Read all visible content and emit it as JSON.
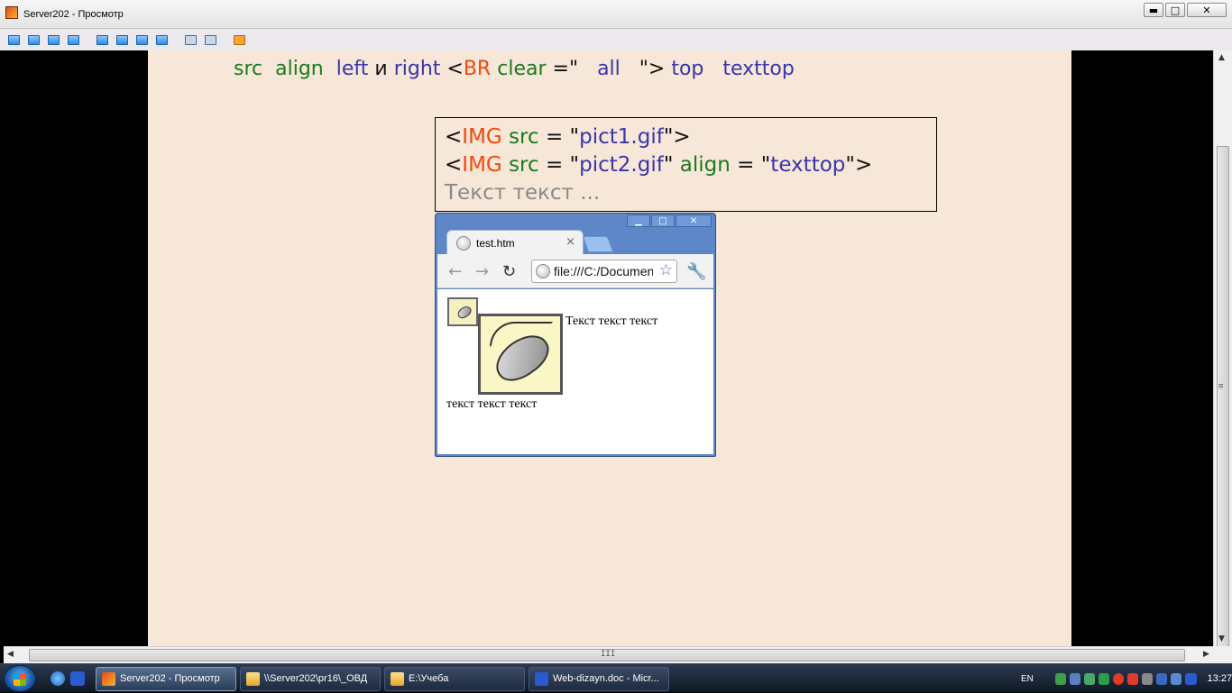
{
  "window": {
    "title": "Server202 - Просмотр",
    "buttons": {
      "minimize": "▬",
      "maximize": "□",
      "close": "✕"
    }
  },
  "toolbar": {
    "icons": [
      "monitor-icon",
      "chat-icon",
      "phone-icon",
      "message-icon",
      "window-icon",
      "fit-icon",
      "fullscreen-icon",
      "scale-icon",
      "copy-icon",
      "tools-icon",
      "close-session-icon"
    ]
  },
  "slide": {
    "topline": {
      "src": "src",
      "align": "align",
      "left": "left",
      "and": "и",
      "right": "right",
      "lt": "<",
      "br": "BR",
      "clear": "clear",
      "eq_quote": "=\"",
      "all": "all",
      "quote_gt": "\">",
      "top": "top",
      "texttop": "texttop"
    },
    "code": {
      "line1": {
        "lt": "<",
        "tag": "IMG",
        "attr": "src",
        "eq": " = ",
        "q1": "\"",
        "value": "pict1.gif",
        "q2_gt": "\">"
      },
      "line2": {
        "lt": "<",
        "tag": "IMG",
        "attr": "src",
        "eq": " = ",
        "q1": "\"",
        "value": "pict2.gif",
        "q2": "\"",
        "attr2": "align",
        "eq2": " = ",
        "q3": "\"",
        "value2": "texttop",
        "q4_gt": "\">"
      },
      "line3": "Текст текст ..."
    },
    "browser": {
      "window_buttons": {
        "minimize": "▁",
        "maximize": "□",
        "close": "✕"
      },
      "tab_title": "test.htm",
      "tab_close": "×",
      "back": "←",
      "forward": "→",
      "reload": "↻",
      "url": "file:///C:/Documents",
      "star": "☆",
      "wrench": "🔧",
      "text_right": "Текст текст текст",
      "text_below": "текст текст текст"
    }
  },
  "scrollbars": {
    "up": "▲",
    "down": "▼",
    "left": "◀",
    "right": "▶",
    "grip": "III"
  },
  "taskbar": {
    "buttons": [
      {
        "label": "Server202 - Просмотр",
        "icon": "app"
      },
      {
        "label": "\\\\Server202\\pr16\\_ОВД",
        "icon": "folder"
      },
      {
        "label": "E:\\Учеба",
        "icon": "folder"
      },
      {
        "label": "Web-dizayn.doc - Micr...",
        "icon": "word"
      }
    ],
    "language": "EN",
    "clock": "13:27",
    "colors": {
      "accent": "#2b3a52"
    }
  },
  "colors": {
    "slide_bg": "#f6e7d8",
    "keyword_green": "#1d7a1d",
    "value_blue": "#3a35a8",
    "tag_red": "#f04a10"
  }
}
